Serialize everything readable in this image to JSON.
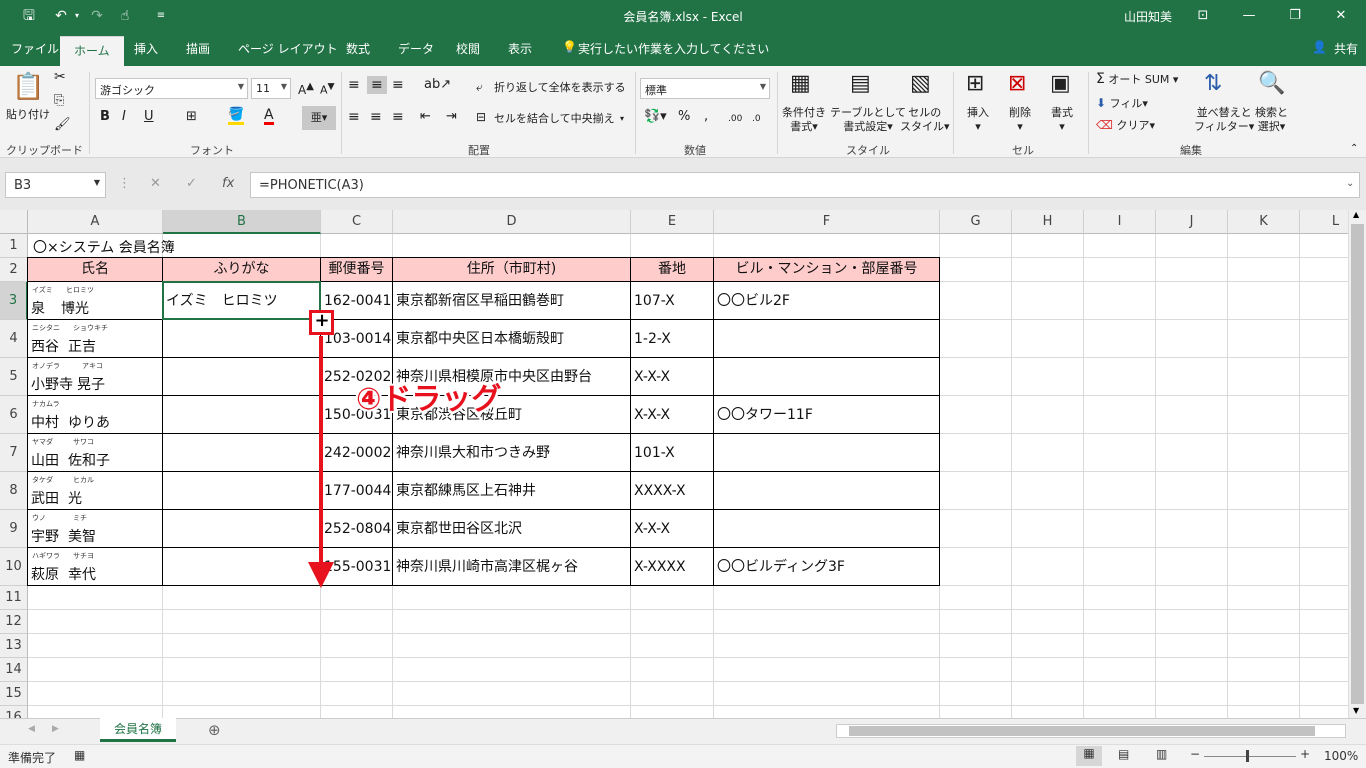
{
  "titlebar": {
    "doc_title": "会員名簿.xlsx  -  Excel",
    "user": "山田知美",
    "save_icon": "save-icon",
    "undo_icon": "undo-icon",
    "redo_icon": "redo-icon",
    "touch_icon": "touch-mode-icon",
    "customize_icon": "customize-icon"
  },
  "ribbon_tabs": [
    "ファイル",
    "ホーム",
    "挿入",
    "描画",
    "ページ レイアウト",
    "数式",
    "データ",
    "校閲",
    "表示"
  ],
  "tell_me": "実行したい作業を入力してください",
  "share": "共有",
  "ribbon": {
    "clipboard": {
      "label": "クリップボード",
      "paste": "貼り付け"
    },
    "font": {
      "label": "フォント",
      "name": "游ゴシック",
      "size": "11"
    },
    "alignment": {
      "label": "配置",
      "wrap": "折り返して全体を表示する",
      "merge": "セルを結合して中央揃え"
    },
    "number": {
      "label": "数値",
      "format": "標準"
    },
    "styles": {
      "label": "スタイル",
      "cond1": "条件付き",
      "cond2": "書式",
      "table1": "テーブルとして",
      "table2": "書式設定",
      "cell1": "セルの",
      "cell2": "スタイル"
    },
    "cells": {
      "label": "セル",
      "insert": "挿入",
      "delete": "削除",
      "format": "書式"
    },
    "editing": {
      "label": "編集",
      "autosum": "オート SUM",
      "fill": "フィル",
      "clear": "クリア",
      "sort1": "並べ替えと",
      "sort2": "フィルター",
      "find1": "検索と",
      "find2": "選択"
    }
  },
  "formula_bar": {
    "name_box": "B3",
    "formula": "=PHONETIC(A3)",
    "cancel": "✕",
    "enter": "✓",
    "fx": "fx"
  },
  "columns": [
    "A",
    "B",
    "C",
    "D",
    "E",
    "F",
    "G",
    "H",
    "I",
    "J",
    "K",
    "L"
  ],
  "rows": [
    "1",
    "2",
    "3",
    "4",
    "5",
    "6",
    "7",
    "8",
    "9",
    "10",
    "11",
    "12",
    "13",
    "14",
    "15",
    "16"
  ],
  "sheet": {
    "title": "〇×システム 会員名簿",
    "headers": [
      "氏名",
      "ふりがな",
      "郵便番号",
      "住所（市町村)",
      "番地",
      "ビル・マンション・部屋番号"
    ],
    "records": [
      {
        "furi_last": "イズミ",
        "furi_first": "ヒロミツ",
        "last": "泉",
        "first": "博光",
        "kana": "イズミ　ヒロミツ",
        "zip": "162-0041",
        "addr": "東京都新宿区早稲田鶴巻町",
        "num": "107-X",
        "bldg": "〇〇ビル2F"
      },
      {
        "furi_last": "ニシタニ",
        "furi_first": "ショウキチ",
        "last": "西谷",
        "first": "正吉",
        "kana": "",
        "zip": "103-0014",
        "addr": "東京都中央区日本橋蛎殻町",
        "num": "1-2-X",
        "bldg": ""
      },
      {
        "furi_last": "オノデラ",
        "furi_first": "アキコ",
        "last": "小野寺",
        "first": "晃子",
        "kana": "",
        "zip": "252-0202",
        "addr": "神奈川県相模原市中央区由野台",
        "num": "X-X-X",
        "bldg": ""
      },
      {
        "furi_last": "ナカムラ",
        "furi_first": "",
        "last": "中村",
        "first": "ゆりあ",
        "kana": "",
        "zip": "150-0031",
        "addr": "東京都渋谷区桜丘町",
        "num": "X-X-X",
        "bldg": "〇〇タワー11F"
      },
      {
        "furi_last": "ヤマダ",
        "furi_first": "サワコ",
        "last": "山田",
        "first": "佐和子",
        "kana": "",
        "zip": "242-0002",
        "addr": "神奈川県大和市つきみ野",
        "num": "101-X",
        "bldg": ""
      },
      {
        "furi_last": "タケダ",
        "furi_first": "ヒカル",
        "last": "武田",
        "first": "光",
        "kana": "",
        "zip": "177-0044",
        "addr": "東京都練馬区上石神井",
        "num": "XXXX-X",
        "bldg": ""
      },
      {
        "furi_last": "ウノ",
        "furi_first": "ミチ",
        "last": "宇野",
        "first": "美智",
        "kana": "",
        "zip": "252-0804",
        "addr": "東京都世田谷区北沢",
        "num": "X-X-X",
        "bldg": ""
      },
      {
        "furi_last": "ハギワラ",
        "furi_first": "サチヨ",
        "last": "萩原",
        "first": "幸代",
        "kana": "",
        "zip": "155-0031",
        "addr": "神奈川県川崎市高津区梶ヶ谷",
        "num": "X-XXXX",
        "bldg": "〇〇ビルディング3F"
      }
    ]
  },
  "annotation": {
    "text": "④ドラッグ",
    "color": "#e8121f"
  },
  "sheet_tab": "会員名簿",
  "status": {
    "ready": "準備完了",
    "zoom": "100%"
  },
  "colors": {
    "accent": "#217346",
    "header_fill": "#ffcccc"
  }
}
